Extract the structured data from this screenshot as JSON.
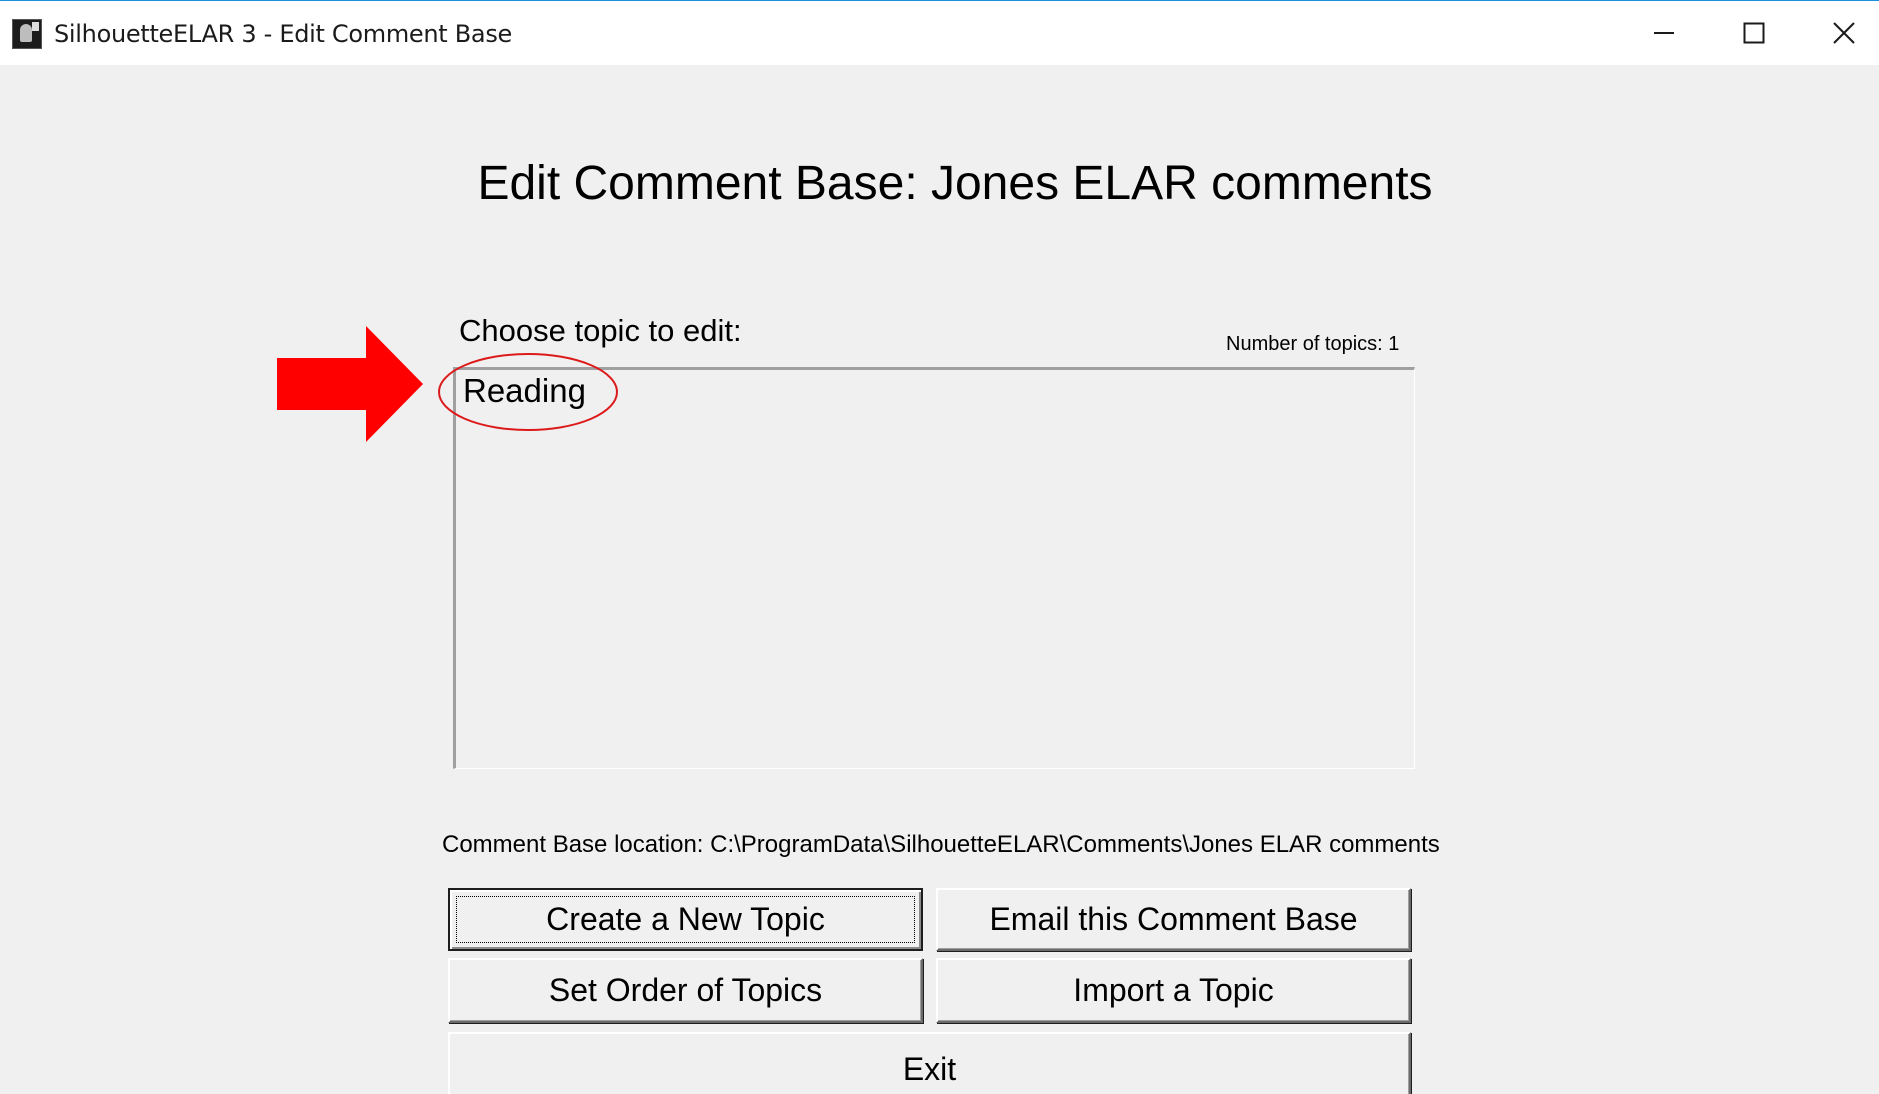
{
  "window": {
    "title": "SilhouetteELAR 3 - Edit Comment Base",
    "controls": [
      "minimize-icon",
      "maximize-icon",
      "close-icon"
    ]
  },
  "main": {
    "heading": "Edit Comment Base: Jones ELAR comments",
    "choose_label": "Choose topic to edit:",
    "topic_count_text": "Number of topics: 1",
    "topics": [
      "Reading"
    ],
    "location_text": "Comment Base location: C:\\ProgramData\\SilhouetteELAR\\Comments\\Jones ELAR comments"
  },
  "annotation": {
    "arrow_color": "#ff0000",
    "ellipse_color": "#dd1a1a"
  },
  "buttons": {
    "create_topic": "Create a New Topic",
    "email_base": "Email this Comment Base",
    "set_order": "Set Order of Topics",
    "import_topic": "Import a Topic",
    "exit": "Exit"
  }
}
